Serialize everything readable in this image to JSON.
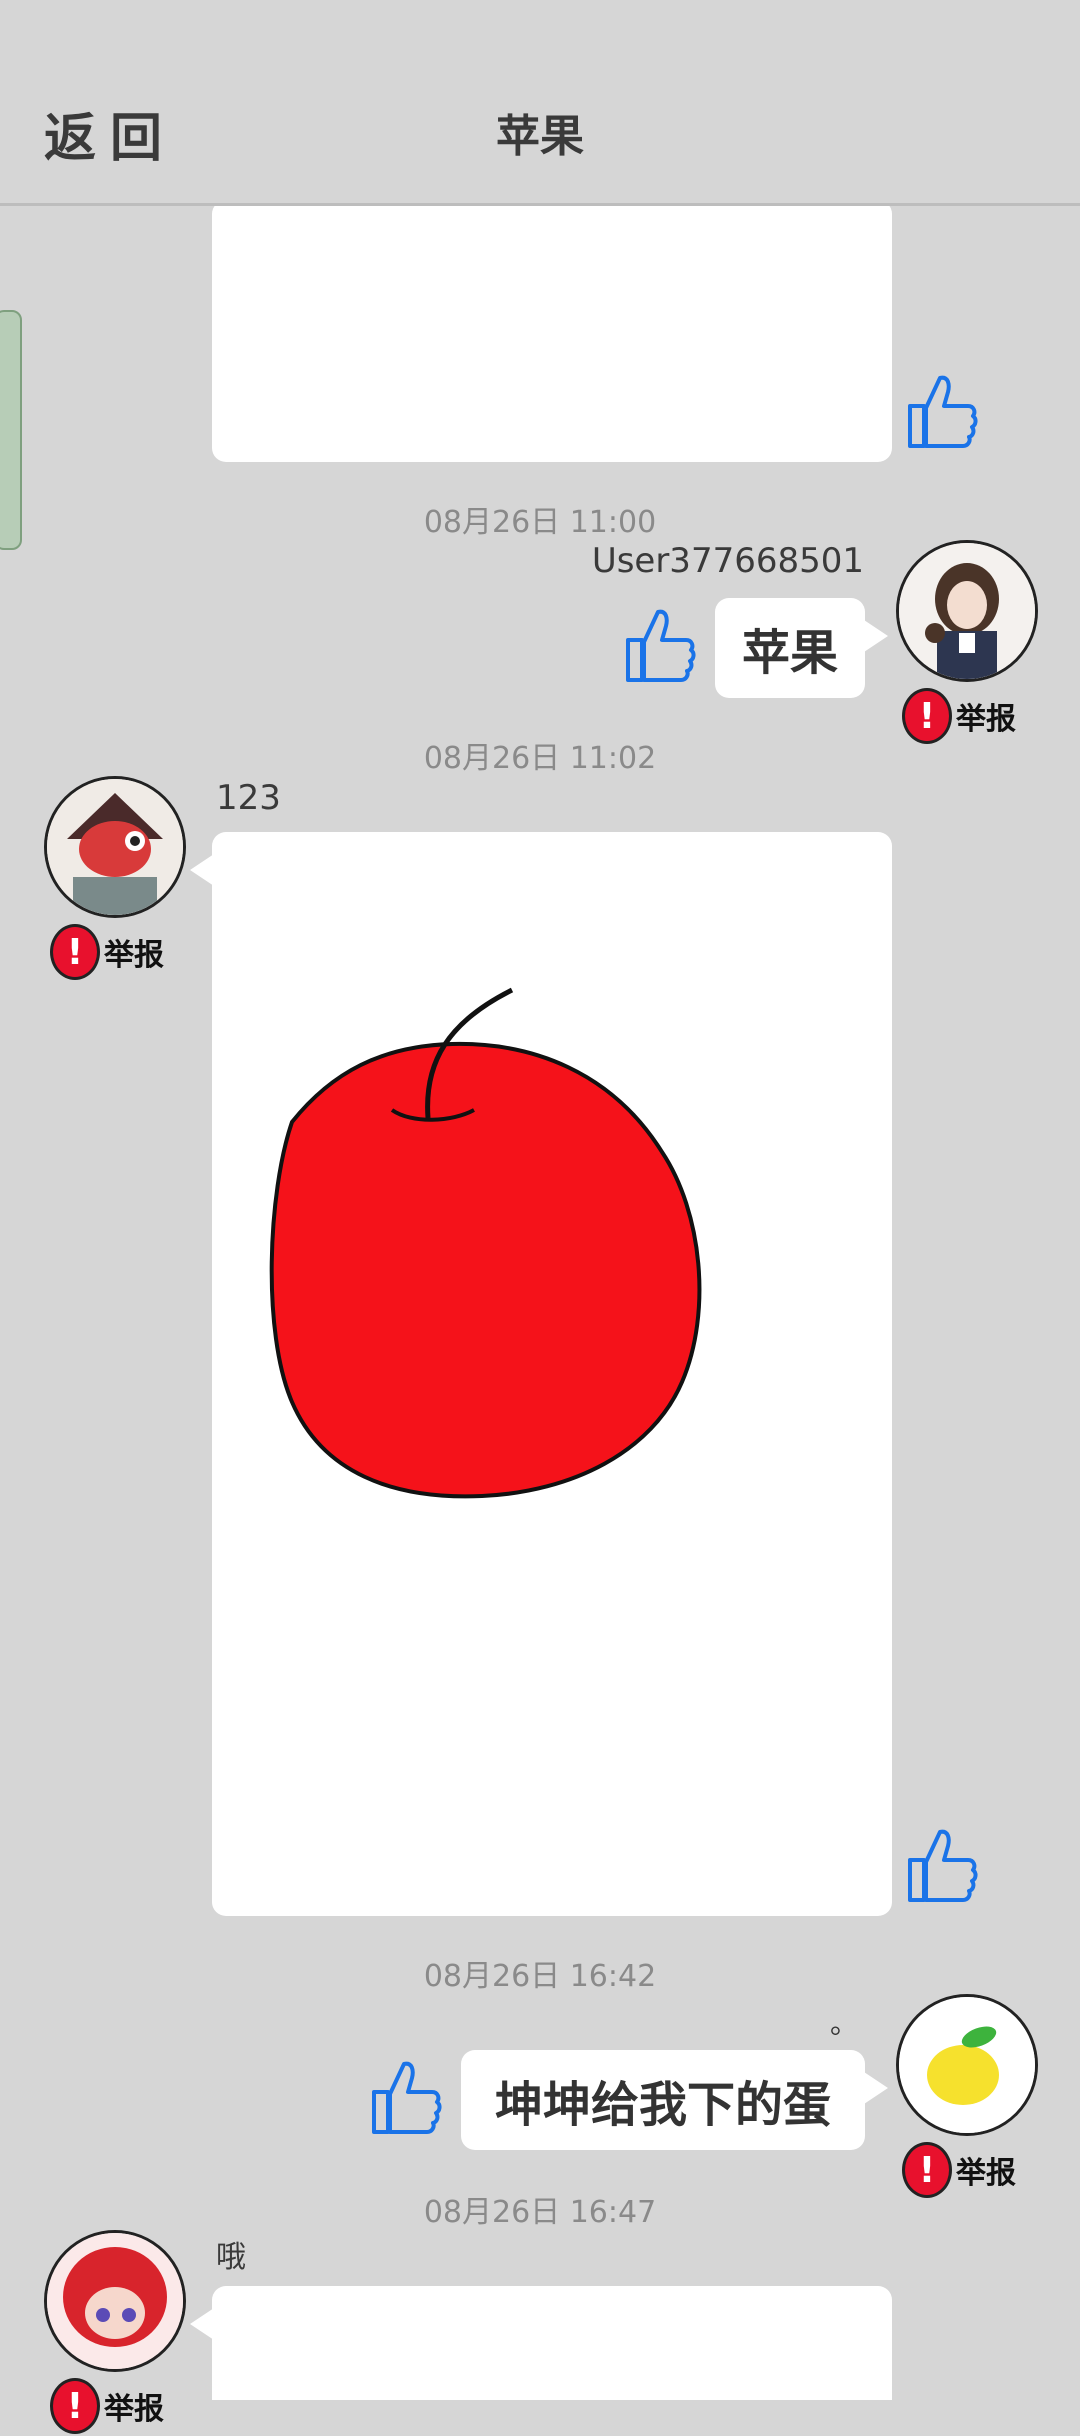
{
  "header": {
    "back_label": "返回",
    "title": "苹果"
  },
  "messages": [
    {
      "timestamp": "08月26日  11:00",
      "sender": "User377668501",
      "text": "苹果",
      "report_label": "举报"
    },
    {
      "timestamp": "08月26日  11:02",
      "sender": "123",
      "report_label": "举报"
    },
    {
      "timestamp": "08月26日  16:42",
      "sender": "。",
      "text": "坤坤给我下的蛋",
      "report_label": "举报"
    },
    {
      "timestamp": "08月26日  16:47",
      "sender": "哦",
      "report_label": "举报"
    }
  ],
  "colors": {
    "background": "#d6d6d6",
    "like": "#1a73e8",
    "report": "#e8112d",
    "apple": "#f5121a"
  },
  "icons": [
    "like-thumb-icon",
    "report-alert-icon"
  ]
}
